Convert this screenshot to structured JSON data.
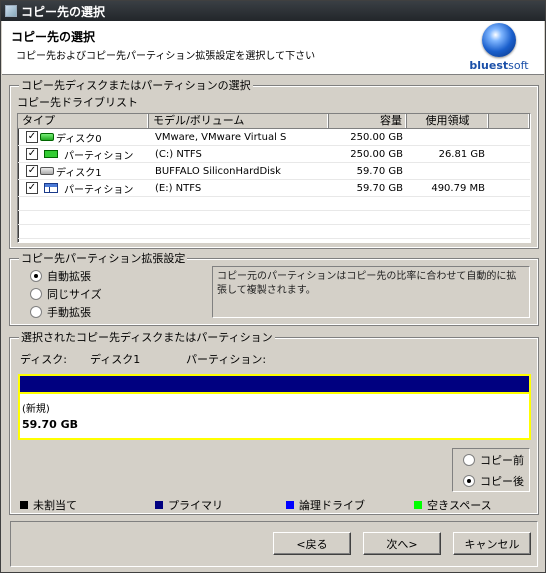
{
  "window": {
    "title": "コピー先の選択"
  },
  "header": {
    "title": "コピー先の選択",
    "subtitle": "コピー先およびコピー先パーティション拡張設定を選択して下さい",
    "logo_main": "bluest",
    "logo_soft": "soft"
  },
  "select_group": {
    "legend": "コピー先ディスクまたはパーティションの選択",
    "list_caption": "コピー先ドライブリスト",
    "columns": [
      "タイプ",
      "モデル/ボリューム",
      "容量",
      "使用領域",
      ""
    ],
    "rows": [
      {
        "type": "ディスク0",
        "model": "VMware, VMware Virtual S",
        "capacity": "250.00 GB",
        "used": "",
        "checked": "✓"
      },
      {
        "type": "パーティション",
        "model": "(C:)  NTFS",
        "capacity": "250.00 GB",
        "used": "26.81 GB",
        "checked": "✓"
      },
      {
        "type": "ディスク1",
        "model": "BUFFALO SiliconHardDisk",
        "capacity": "59.70 GB",
        "used": "",
        "checked": "✓"
      },
      {
        "type": "パーティション",
        "model": "(E:)  NTFS",
        "capacity": "59.70 GB",
        "used": "490.79 MB",
        "checked": "✓"
      }
    ]
  },
  "expand_group": {
    "legend": "コピー先パーティション拡張設定",
    "options": [
      "自動拡張",
      "同じサイズ",
      "手動拡張"
    ],
    "selected_index": 0,
    "description": "コピー元のパーティションはコピー先の比率に合わせて自動的に拡張して複製されます。"
  },
  "selected_group": {
    "legend": "選択されたコピー先ディスクまたはパーティション",
    "disk_label": "ディスク:",
    "disk_value": "ディスク1",
    "partition_label": "パーティション:",
    "partition_value": "",
    "new_label": "(新規)",
    "size": "59.70 GB",
    "bar_color": "#000080",
    "highlight_color": "#ffff00"
  },
  "view_options": {
    "before": "コピー前",
    "after": "コピー後",
    "selected": "after"
  },
  "legend_items": [
    {
      "label": "未割当て",
      "color": "#000000"
    },
    {
      "label": "プライマリ",
      "color": "#000080"
    },
    {
      "label": "論理ドライブ",
      "color": "#0000ff"
    },
    {
      "label": "空きスペース",
      "color": "#00ff00"
    }
  ],
  "buttons": {
    "back": "<戻る",
    "next": "次へ>",
    "cancel": "キャンセル"
  }
}
